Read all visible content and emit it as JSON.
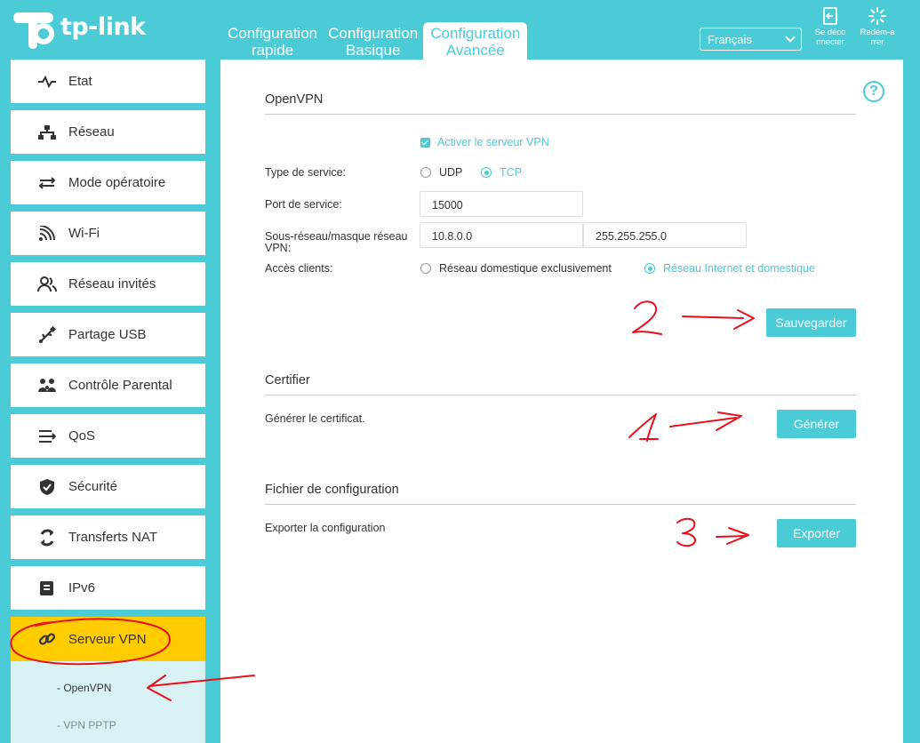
{
  "brand": {
    "name": "tp-link"
  },
  "header": {
    "tabs": [
      {
        "line1": "Configuration",
        "line2": "rapide"
      },
      {
        "line1": "Configuration",
        "line2": "Basique"
      },
      {
        "line1": "Configuration",
        "line2": "Avancée"
      }
    ],
    "language": "Français",
    "logout_line1": "Se déco",
    "logout_line2": "nnecter",
    "reboot_line1": "Redém-a",
    "reboot_line2": "rrer"
  },
  "sidebar": {
    "items": [
      {
        "label": "Etat",
        "icon": "pulse-icon"
      },
      {
        "label": "Réseau",
        "icon": "network-icon"
      },
      {
        "label": "Mode opératoire",
        "icon": "mode-switch-icon"
      },
      {
        "label": "Wi-Fi",
        "icon": "wifi-icon"
      },
      {
        "label": "Réseau invités",
        "icon": "guests-icon"
      },
      {
        "label": "Partage USB",
        "icon": "usb-icon"
      },
      {
        "label": "Contrôle Parental",
        "icon": "family-icon"
      },
      {
        "label": "QoS",
        "icon": "qos-icon"
      },
      {
        "label": "Sécurité",
        "icon": "shield-icon"
      },
      {
        "label": "Transferts NAT",
        "icon": "nat-icon"
      },
      {
        "label": "IPv6",
        "icon": "ipv6-icon"
      },
      {
        "label": "Serveur VPN",
        "icon": "link-icon"
      }
    ],
    "sub_items": [
      {
        "label": "- OpenVPN"
      },
      {
        "label": "- VPN PPTP"
      }
    ]
  },
  "openvpn": {
    "title": "OpenVPN",
    "enable_label": "Activer le serveur VPN",
    "enabled": true,
    "service_type_label": "Type de service:",
    "service_type_options": [
      "UDP",
      "TCP"
    ],
    "service_type_value": "TCP",
    "port_label": "Port de service:",
    "port_value": "15000",
    "subnet_label_line1": "Sous-réseau/masque réseau",
    "subnet_label_line2": "VPN:",
    "subnet_value": "10.8.0.0",
    "mask_value": "255.255.255.0",
    "access_label": "Accès clients:",
    "access_options": [
      "Réseau domestique exclusivement",
      "Réseau Internet et domestique"
    ],
    "access_value": "Réseau Internet et domestique",
    "save_button": "Sauvegarder"
  },
  "certificate": {
    "title": "Certifier",
    "text": "Générer le certificat.",
    "button": "Générer"
  },
  "config_file": {
    "title": "Fichier de configuration",
    "text": "Exporter la configuration",
    "button": "Exporter"
  },
  "annotations": {
    "color": "#e8101a",
    "marks": [
      "1",
      "2",
      "3"
    ]
  },
  "colors": {
    "accent": "#4acbd6",
    "active_menu": "#ffcc00",
    "submenu_bg": "#d9f3f5"
  }
}
